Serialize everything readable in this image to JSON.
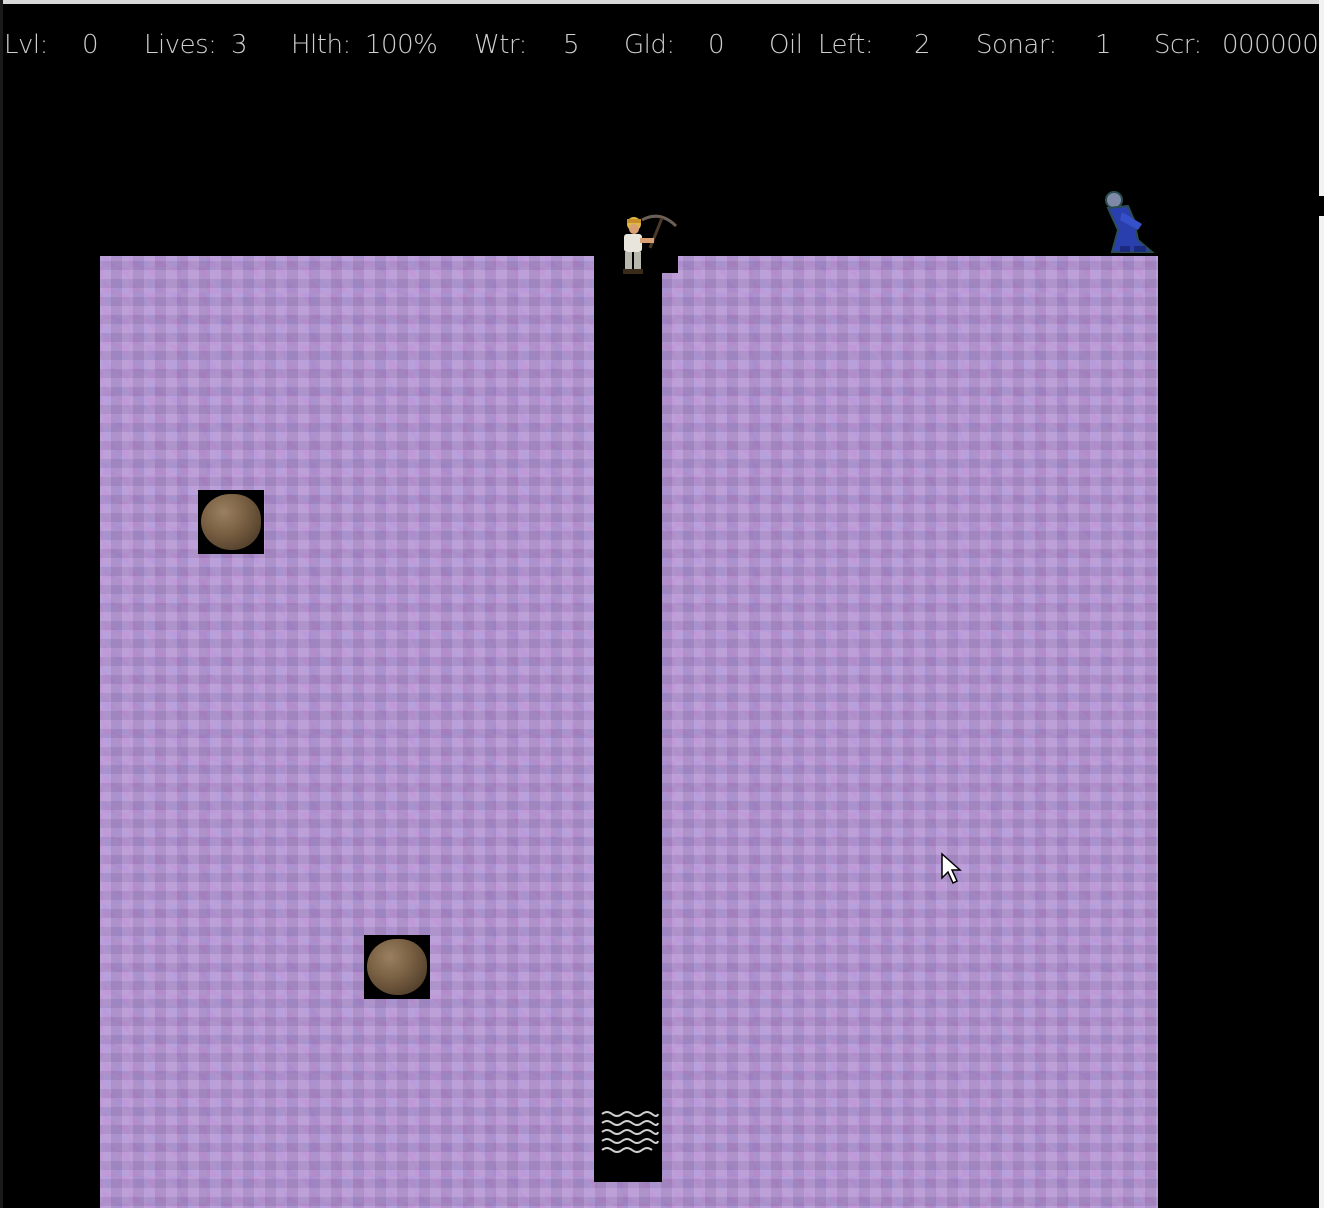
{
  "hud": {
    "level_label": "Lvl:",
    "level_value": "0",
    "lives_label": "Lives:",
    "lives_value": "3",
    "health_label": "Hlth:",
    "health_value": "100%",
    "water_label": "Wtr:",
    "water_value": "5",
    "gold_label": "Gld:",
    "gold_value": "0",
    "oil_label": "Oil  Left:",
    "oil_value": "2",
    "sonar_label": "Sonar:",
    "sonar_value": "1",
    "score_label": "Scr:",
    "score_value": "000000"
  },
  "colors": {
    "background": "#000000",
    "dirt": "#b595d4",
    "hud_text": "#cfcfcf",
    "protester": "#2a3fae",
    "boulder": "#7a6144"
  },
  "sprites": {
    "player": "miner-with-pickaxe-icon",
    "protester": "blue-protester-icon",
    "boulders": [
      "boulder-icon",
      "boulder-icon"
    ],
    "water": "water-pool-icon",
    "cursor": "mouse-cursor-icon"
  }
}
